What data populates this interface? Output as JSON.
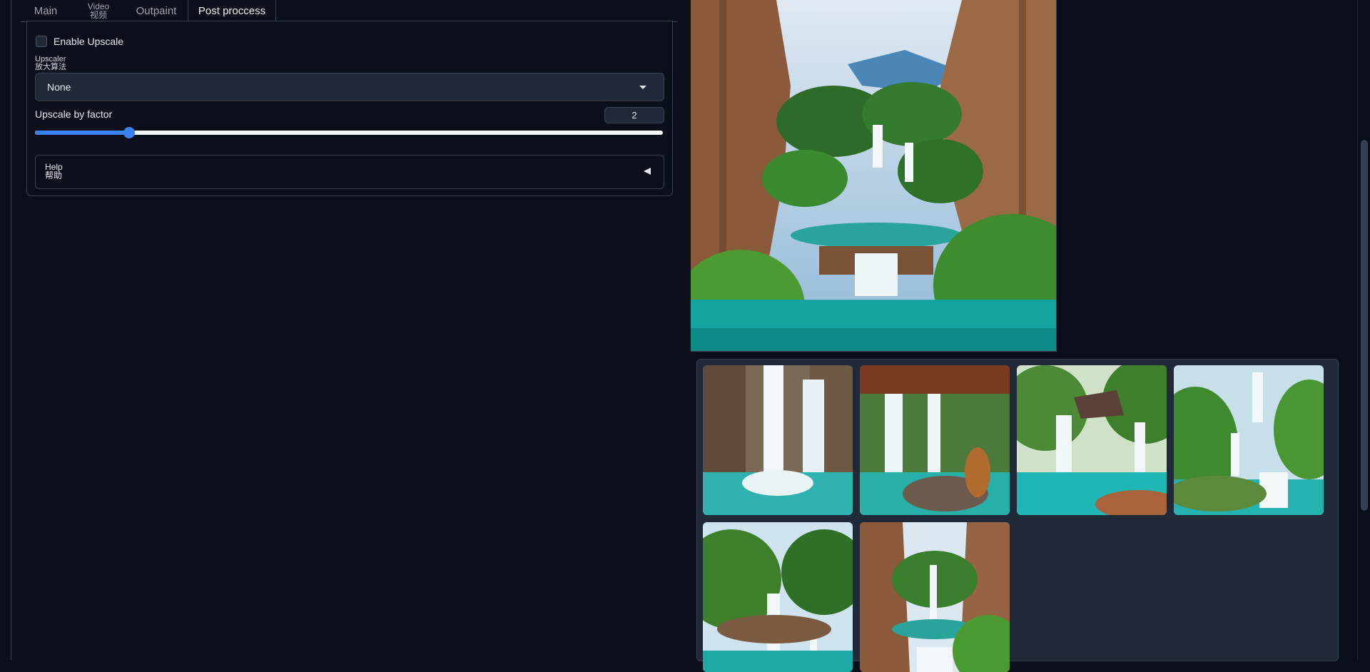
{
  "tabs": [
    {
      "label": "Main"
    },
    {
      "label_en": "Video",
      "label_zh": "视频"
    },
    {
      "label": "Outpaint"
    },
    {
      "label": "Post proccess"
    }
  ],
  "upscale": {
    "enable_label": "Enable Upscale",
    "enabled": false,
    "upscaler_label_en": "Upscaler",
    "upscaler_label_zh": "放大算法",
    "upscaler_value": "None",
    "factor_label": "Upscale by factor",
    "factor_value": "2",
    "factor_fraction": 0.15
  },
  "help": {
    "label_en": "Help",
    "label_zh": "帮助"
  },
  "colors": {
    "background": "#0b0f19",
    "accent": "#3b82f6",
    "border": "#374151"
  },
  "gallery": {
    "main_image": "waterfall-canyon",
    "thumbnails": [
      "waterfall-animal-1",
      "waterfall-animal-2",
      "waterfall-animal-3",
      "waterfall-animal-4",
      "waterfall-animal-5",
      "waterfall-canyon-6"
    ]
  }
}
